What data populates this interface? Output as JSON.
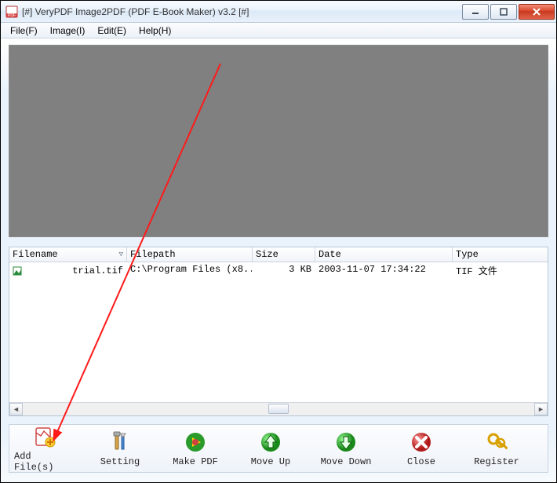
{
  "title": "[#] VeryPDF Image2PDF (PDF E-Book Maker) v3.2 [#]",
  "menu": {
    "file": "File(F)",
    "image": "Image(I)",
    "edit": "Edit(E)",
    "help": "Help(H)"
  },
  "grid": {
    "headers": {
      "filename": "Filename",
      "filepath": "Filepath",
      "size": "Size",
      "date": "Date",
      "type": "Type"
    },
    "rows": [
      {
        "filename": "trial.tif",
        "filepath": "C:\\Program Files (x8...",
        "size": "3 KB",
        "date": "2003-11-07 17:34:22",
        "type": "TIF 文件"
      }
    ]
  },
  "toolbar": {
    "addfiles": "Add File(s)",
    "setting": "Setting",
    "makepdf": "Make PDF",
    "moveup": "Move Up",
    "movedown": "Move Down",
    "close": "Close",
    "register": "Register"
  }
}
